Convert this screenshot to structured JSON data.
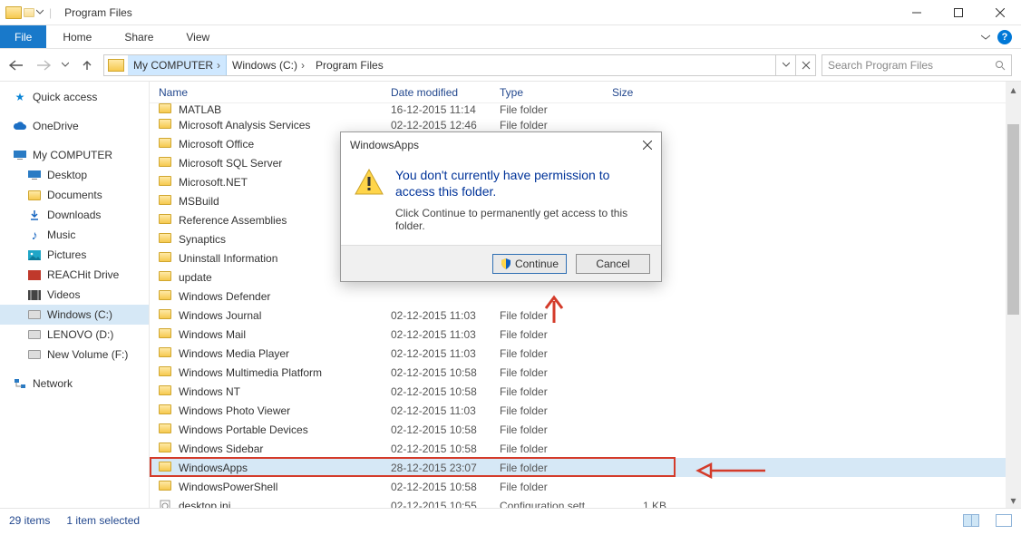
{
  "window": {
    "title": "Program Files"
  },
  "ribbon": {
    "file": "File",
    "tabs": [
      "Home",
      "Share",
      "View"
    ]
  },
  "breadcrumb": {
    "root": "My COMPUTER",
    "drive": "Windows (C:)",
    "folder": "Program Files"
  },
  "search": {
    "placeholder": "Search Program Files"
  },
  "tree": {
    "quick_access": "Quick access",
    "onedrive": "OneDrive",
    "my_computer": "My COMPUTER",
    "subs": [
      {
        "k": "desktop",
        "label": "Desktop",
        "icon": "desktop"
      },
      {
        "k": "documents",
        "label": "Documents",
        "icon": "folder"
      },
      {
        "k": "downloads",
        "label": "Downloads",
        "icon": "download"
      },
      {
        "k": "music",
        "label": "Music",
        "icon": "music"
      },
      {
        "k": "pictures",
        "label": "Pictures",
        "icon": "picture"
      },
      {
        "k": "reachit",
        "label": "REACHit Drive",
        "icon": "reachit"
      },
      {
        "k": "videos",
        "label": "Videos",
        "icon": "video"
      },
      {
        "k": "c",
        "label": "Windows (C:)",
        "icon": "drive",
        "sel": true
      },
      {
        "k": "d",
        "label": "LENOVO (D:)",
        "icon": "drive"
      },
      {
        "k": "f",
        "label": "New Volume (F:)",
        "icon": "drive"
      }
    ],
    "network": "Network"
  },
  "columns": {
    "name": "Name",
    "date": "Date modified",
    "type": "Type",
    "size": "Size"
  },
  "rows": [
    {
      "name": "MATLAB",
      "date": "16-12-2015 11:14",
      "type": "File folder",
      "size": "",
      "ico": "folder",
      "clip": true
    },
    {
      "name": "Microsoft Analysis Services",
      "date": "02-12-2015 12:46",
      "type": "File folder",
      "size": "",
      "ico": "folder"
    },
    {
      "name": "Microsoft Office",
      "date": "",
      "type": "",
      "size": "",
      "ico": "folder"
    },
    {
      "name": "Microsoft SQL Server",
      "date": "",
      "type": "",
      "size": "",
      "ico": "folder"
    },
    {
      "name": "Microsoft.NET",
      "date": "",
      "type": "",
      "size": "",
      "ico": "folder"
    },
    {
      "name": "MSBuild",
      "date": "",
      "type": "",
      "size": "",
      "ico": "folder"
    },
    {
      "name": "Reference Assemblies",
      "date": "",
      "type": "",
      "size": "",
      "ico": "folder"
    },
    {
      "name": "Synaptics",
      "date": "",
      "type": "",
      "size": "",
      "ico": "folder"
    },
    {
      "name": "Uninstall Information",
      "date": "",
      "type": "",
      "size": "",
      "ico": "folder"
    },
    {
      "name": "update",
      "date": "",
      "type": "",
      "size": "",
      "ico": "folder"
    },
    {
      "name": "Windows Defender",
      "date": "",
      "type": "",
      "size": "",
      "ico": "folder"
    },
    {
      "name": "Windows Journal",
      "date": "02-12-2015 11:03",
      "type": "File folder",
      "size": "",
      "ico": "folder"
    },
    {
      "name": "Windows Mail",
      "date": "02-12-2015 11:03",
      "type": "File folder",
      "size": "",
      "ico": "folder"
    },
    {
      "name": "Windows Media Player",
      "date": "02-12-2015 11:03",
      "type": "File folder",
      "size": "",
      "ico": "folder"
    },
    {
      "name": "Windows Multimedia Platform",
      "date": "02-12-2015 10:58",
      "type": "File folder",
      "size": "",
      "ico": "folder"
    },
    {
      "name": "Windows NT",
      "date": "02-12-2015 10:58",
      "type": "File folder",
      "size": "",
      "ico": "folder"
    },
    {
      "name": "Windows Photo Viewer",
      "date": "02-12-2015 11:03",
      "type": "File folder",
      "size": "",
      "ico": "folder"
    },
    {
      "name": "Windows Portable Devices",
      "date": "02-12-2015 10:58",
      "type": "File folder",
      "size": "",
      "ico": "folder"
    },
    {
      "name": "Windows Sidebar",
      "date": "02-12-2015 10:58",
      "type": "File folder",
      "size": "",
      "ico": "folder"
    },
    {
      "name": "WindowsApps",
      "date": "28-12-2015 23:07",
      "type": "File folder",
      "size": "",
      "ico": "folder",
      "sel": true,
      "hilite": true
    },
    {
      "name": "WindowsPowerShell",
      "date": "02-12-2015 10:58",
      "type": "File folder",
      "size": "",
      "ico": "folder"
    },
    {
      "name": "desktop.ini",
      "date": "02-12-2015 10:55",
      "type": "Configuration sett...",
      "size": "1 KB",
      "ico": "ini"
    }
  ],
  "status": {
    "count": "29 items",
    "selection": "1 item selected"
  },
  "dialog": {
    "title": "WindowsApps",
    "headline": "You don't currently have permission to access this folder.",
    "sub": "Click Continue to permanently get access to this folder.",
    "continue": "Continue",
    "cancel": "Cancel"
  }
}
